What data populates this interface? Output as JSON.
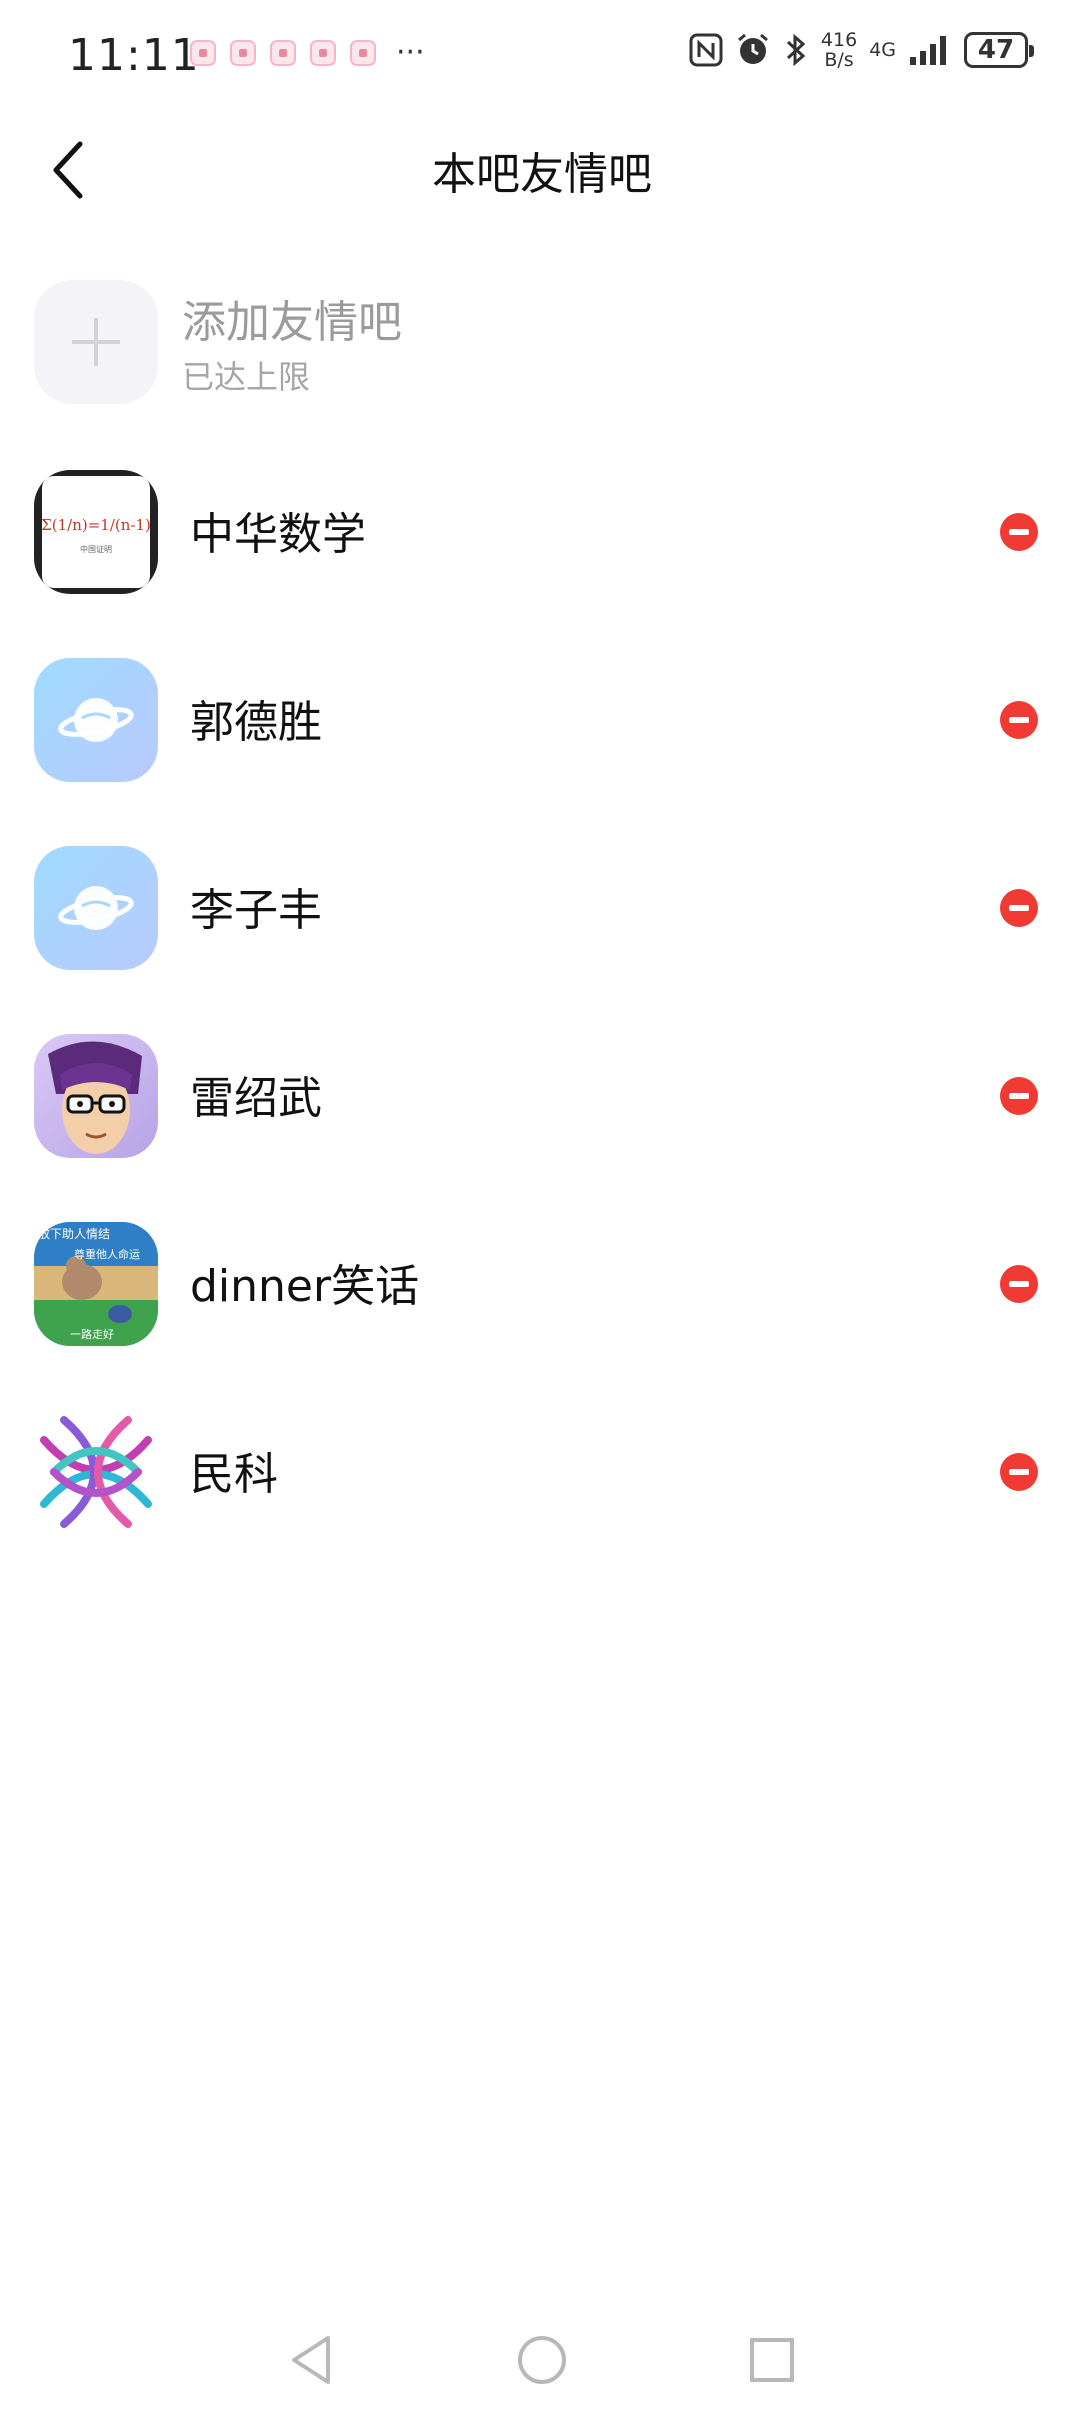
{
  "status_bar": {
    "time": "11:11",
    "more": "···",
    "speed_value": "416",
    "speed_unit": "B/s",
    "network": "4G",
    "battery": "47",
    "icons": [
      "nfc-icon",
      "alarm-icon",
      "bluetooth-icon",
      "signal-icon",
      "battery-icon"
    ]
  },
  "header": {
    "title": "本吧友情吧"
  },
  "add_friend": {
    "title": "添加友情吧",
    "subtitle": "已达上限"
  },
  "friends": [
    {
      "name": "中华数学",
      "avatar": "math-formula-avatar"
    },
    {
      "name": "郭德胜",
      "avatar": "planet-default-avatar"
    },
    {
      "name": "李子丰",
      "avatar": "planet-default-avatar"
    },
    {
      "name": "雷绍武",
      "avatar": "cartoon-glasses-man-avatar"
    },
    {
      "name": "dinner笑话",
      "avatar": "cartoon-dog-avatar"
    },
    {
      "name": "民科",
      "avatar": "colorful-knot-avatar"
    }
  ],
  "avatar_text": {
    "math_formula": "Σ(1/n)=1/(n-1)",
    "math_caption": "中国证明",
    "dog_top": "放下助人情结",
    "dog_mid": "尊重他人命运",
    "dog_bottom": "一路走好"
  },
  "colors": {
    "remove_red": "#f23a35",
    "muted_text": "#9b9b9b",
    "planet_blue": "#a9d7ff"
  }
}
